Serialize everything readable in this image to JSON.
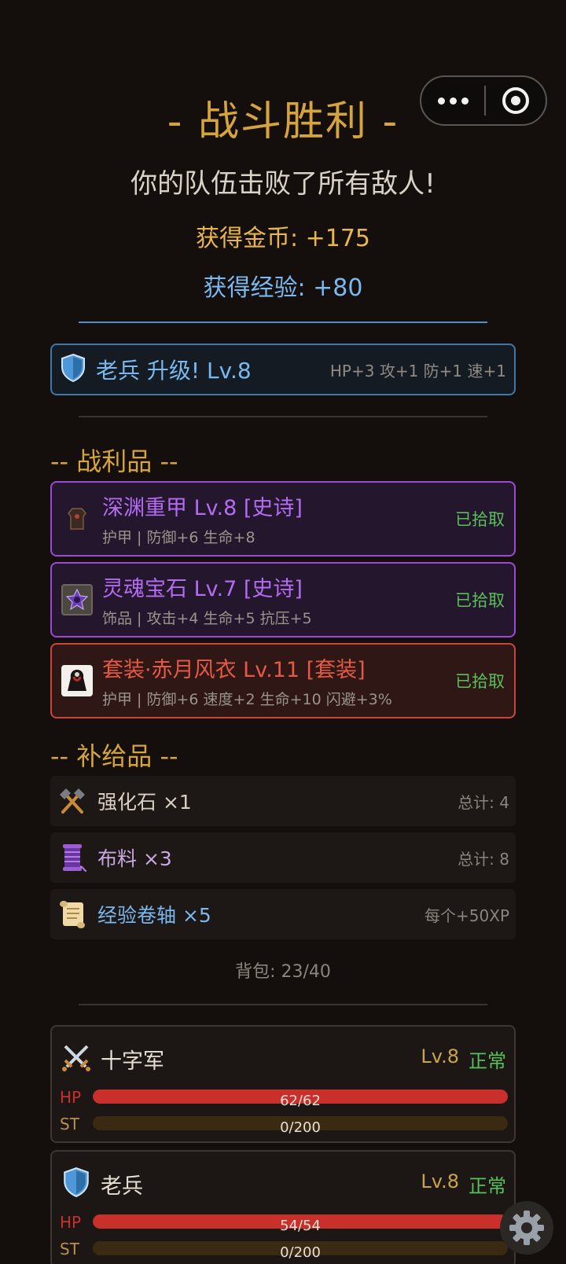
{
  "title": "- 战斗胜利 -",
  "subtitle": "你的队伍击败了所有敌人!",
  "rewards": {
    "gold": "获得金币: +175",
    "exp": "获得经验: +80"
  },
  "level_up": {
    "name": "老兵 升级! Lv.8",
    "stats": "HP+3 攻+1 防+1 速+1",
    "icon": "shield-icon"
  },
  "loot_section": {
    "title": "-- 战利品 --"
  },
  "loot": [
    {
      "name": "深渊重甲 Lv.8 [史诗]",
      "desc": "护甲 | 防御+6 生命+8",
      "status": "已拾取",
      "rarity": "epic",
      "icon": "armor-icon"
    },
    {
      "name": "灵魂宝石 Lv.7 [史诗]",
      "desc": "饰品 | 攻击+4 生命+5 抗压+5",
      "status": "已拾取",
      "rarity": "epic",
      "icon": "gem-icon"
    },
    {
      "name": "套装·赤月风衣 Lv.11 [套装]",
      "desc": "护甲 | 防御+6 速度+2 生命+10 闪避+3%",
      "status": "已拾取",
      "rarity": "set",
      "icon": "cloak-icon"
    }
  ],
  "supply_section": {
    "title": "-- 补给品 --"
  },
  "supplies": [
    {
      "name": "强化石 ×1",
      "note": "总计: 4",
      "color": "#d8cfc2",
      "icon": "hammer-pick-icon"
    },
    {
      "name": "布料 ×3",
      "note": "总计: 8",
      "color": "#c9a8e0",
      "icon": "cloth-spool-icon"
    },
    {
      "name": "经验卷轴 ×5",
      "note": "每个+50XP",
      "color": "#7ab8f0",
      "icon": "scroll-icon"
    }
  ],
  "bag": "背包: 23/40",
  "heroes": [
    {
      "name": "十字军",
      "level": "Lv.8",
      "status": "正常",
      "icon": "crossed-swords-icon",
      "hp_label": "HP",
      "hp_text": "62/62",
      "hp_fraction": 1.0,
      "st_label": "ST",
      "st_text": "0/200",
      "st_fraction": 0.0
    },
    {
      "name": "老兵",
      "level": "Lv.8",
      "status": "正常",
      "icon": "shield-icon",
      "hp_label": "HP",
      "hp_text": "54/54",
      "hp_fraction": 1.0,
      "st_label": "ST",
      "st_text": "0/200",
      "st_fraction": 0.0
    }
  ],
  "colors": {
    "accent_gold": "#d6a43c",
    "exp_blue": "#7ab8f0",
    "epic": "#b36cf2",
    "set": "#e65a45",
    "picked": "#58c05a",
    "hp": "#c9302c",
    "st_track": "#3a2a12"
  }
}
